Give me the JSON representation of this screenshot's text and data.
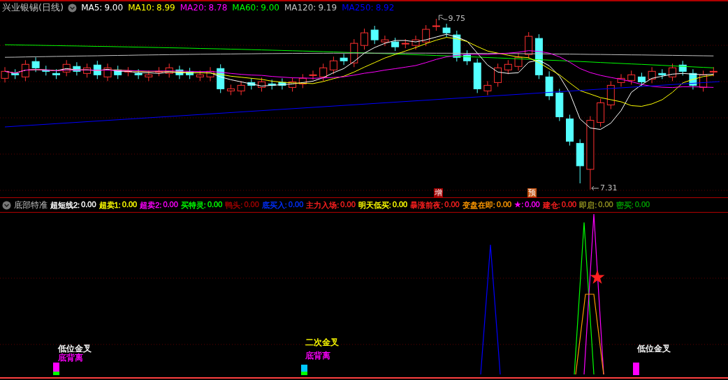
{
  "security": {
    "name": "兴业银锡(日线)"
  },
  "ma_legend": [
    {
      "label": "MA5:",
      "value": "9.00",
      "color": "#ffffff"
    },
    {
      "label": "MA10:",
      "value": "8.99",
      "color": "#ffff00"
    },
    {
      "label": "MA20:",
      "value": "8.78",
      "color": "#ff00ff"
    },
    {
      "label": "MA60:",
      "value": "9.00",
      "color": "#00ff00"
    },
    {
      "label": "MA120:",
      "value": "9.19",
      "color": "#c0c0c0"
    },
    {
      "label": "MA250:",
      "value": "8.92",
      "color": "#0000ff"
    }
  ],
  "price_pane": {
    "high_marker": "9.75",
    "low_marker": "7.31",
    "signals": [
      {
        "text": "增",
        "color": "#a00000"
      },
      {
        "text": "预",
        "color": "#c05010"
      }
    ]
  },
  "indicator": {
    "name": "底部特准",
    "items": [
      {
        "label": "超短线2:",
        "value": "0.00",
        "color": "#ffffff"
      },
      {
        "label": "超卖1:",
        "value": "0.00",
        "color": "#ffff00"
      },
      {
        "label": "超卖2:",
        "value": "0.00",
        "color": "#ff00ff"
      },
      {
        "label": "买特灵:",
        "value": "0.00",
        "color": "#00ff00"
      },
      {
        "label": "鸭头:",
        "value": "0.00",
        "color": "#a00000"
      },
      {
        "label": "底买入:",
        "value": "0.00",
        "color": "#0030ff"
      },
      {
        "label": "主力入场:",
        "value": "0.00",
        "color": "#ff2020"
      },
      {
        "label": "明天低买:",
        "value": "0.00",
        "color": "#ffff00"
      },
      {
        "label": "暴涨前夜:",
        "value": "0.00",
        "color": "#ff2020"
      },
      {
        "label": "变盘在即:",
        "value": "0.00",
        "color": "#ff9900"
      },
      {
        "label": "★:",
        "value": "0.00",
        "color": "#ff00ff"
      },
      {
        "label": "建仓:",
        "value": "0.00",
        "color": "#ff2020"
      },
      {
        "label": "即启:",
        "value": "0.00",
        "color": "#909020"
      },
      {
        "label": "密买:",
        "value": "0.00",
        "color": "#009900"
      }
    ]
  },
  "indicator_pane": {
    "labels": [
      {
        "text": "低位金叉",
        "color": "#ffffff"
      },
      {
        "text": "底背离",
        "color": "#ff00ff"
      },
      {
        "text": "二次金叉",
        "color": "#ffff00"
      },
      {
        "text": "底背离",
        "color": "#ff00ff"
      },
      {
        "text": "低位金叉",
        "color": "#ffffff"
      }
    ]
  }
}
